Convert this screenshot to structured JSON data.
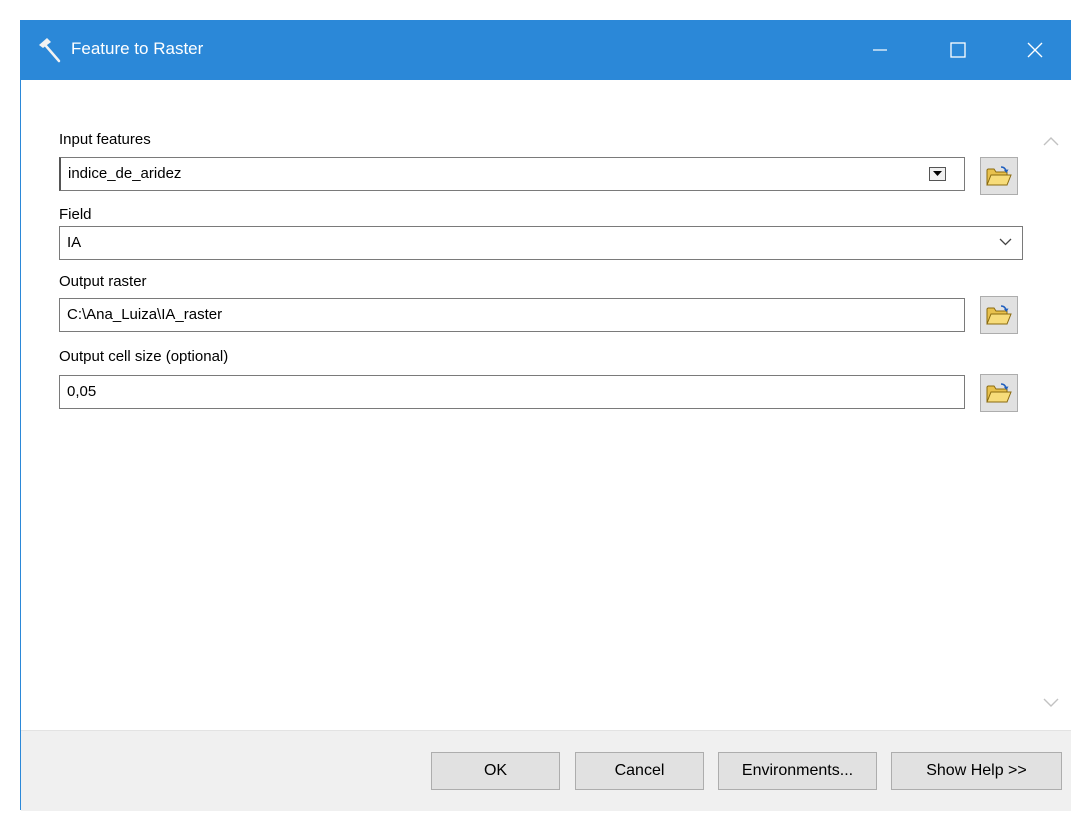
{
  "window": {
    "title": "Feature to Raster",
    "title_bar_color": "#2b88d8",
    "controls": [
      "minimize-icon",
      "maximize-icon",
      "close-icon"
    ]
  },
  "form": {
    "input_features": {
      "label": "Input features",
      "value": "indice_de_aridez"
    },
    "field": {
      "label": "Field",
      "value": "IA"
    },
    "output_raster": {
      "label": "Output raster",
      "value": "C:\\Ana_Luiza\\IA_raster"
    },
    "cell_size": {
      "label": "Output cell size (optional)",
      "value": "0,05"
    }
  },
  "icons": {
    "browse": "folder-open-icon",
    "tool": "hammer-icon"
  },
  "buttons": {
    "ok": "OK",
    "cancel": "Cancel",
    "environments": "Environments...",
    "show_help": "Show Help >>"
  }
}
